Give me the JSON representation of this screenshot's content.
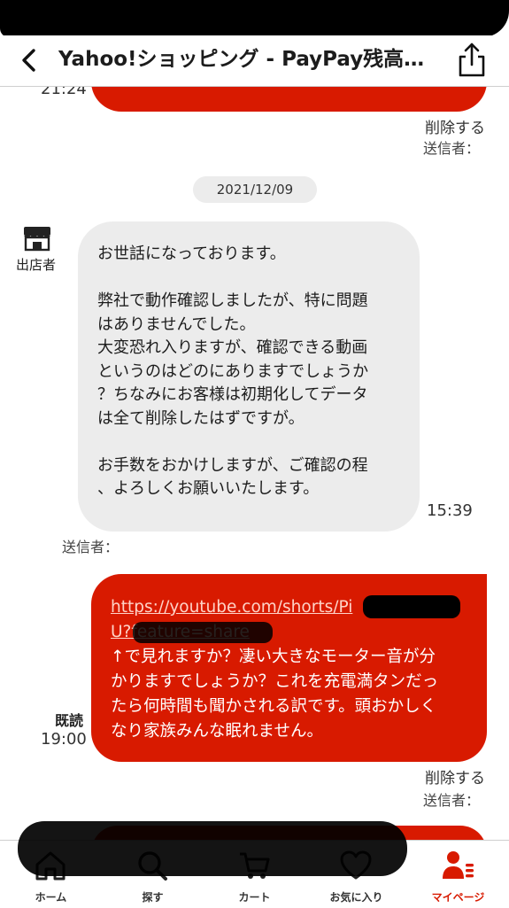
{
  "header": {
    "title": "Yahoo!ショッピング - PayPay残高…"
  },
  "thread": {
    "prev_time": "21:24",
    "prev_delete": "削除する",
    "prev_sender": "送信者：",
    "date": "2021/12/09",
    "store_label": "出店者",
    "incoming": {
      "lines": [
        "お世話になっております。",
        "",
        "弊社で動作確認しましたが、特に問題",
        "はありませんでした。",
        "大変恐れ入りますが、確認できる動画",
        "というのはどのにありますでしょうか",
        "？ちなみにお客様は初期化してデータ",
        "は全て削除したはずですが。",
        "",
        "お手数をおかけしますが、ご確認の程",
        "、よろしくお願いいたします。"
      ],
      "time": "15:39",
      "sender": "送信者："
    },
    "outgoing": {
      "link_line1": "https://youtube.com/shorts/Pi",
      "link_line2": "U?feature=share",
      "text_lines": [
        "↑で見れますか？凄い大きなモーター音が分",
        "かりますでしょうか？これを充電満タンだっ",
        "たら何時間も聞かされる訳です。頭おかしく",
        "なり家族みんな眠れません。"
      ],
      "read_label": "既読",
      "time": "19:00",
      "delete": "削除する",
      "sender": "送信者："
    }
  },
  "tabbar": {
    "items": [
      {
        "label": "ホーム",
        "icon": "home-icon"
      },
      {
        "label": "探す",
        "icon": "search-icon"
      },
      {
        "label": "カート",
        "icon": "cart-icon"
      },
      {
        "label": "お気に入り",
        "icon": "heart-icon"
      },
      {
        "label": "マイページ",
        "icon": "person-icon"
      }
    ],
    "active_index": 4
  },
  "colors": {
    "accent": "#d81a00",
    "incoming_bubble": "#ececec",
    "date_pill": "#ececec"
  }
}
